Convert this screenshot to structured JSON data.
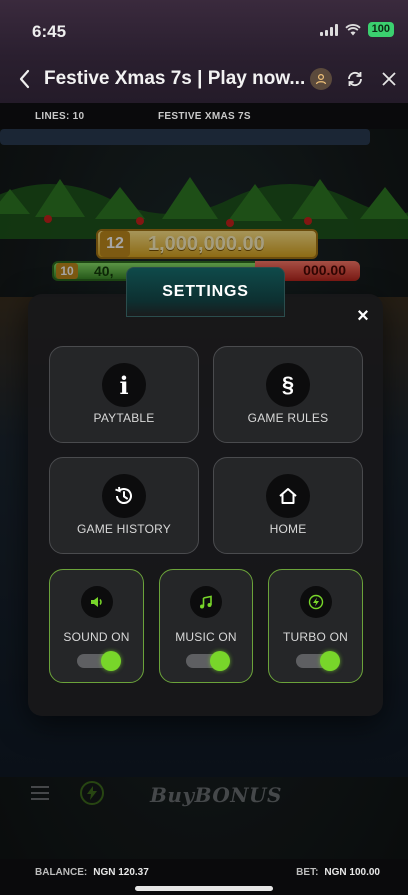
{
  "status": {
    "time": "6:45",
    "battery": "100"
  },
  "browser": {
    "title": "Festive Xmas 7s | Play now..."
  },
  "infobar": {
    "lines": "LINES: 10",
    "game_name": "FESTIVE XMAS 7S"
  },
  "jackpots": {
    "top_count": "12",
    "top_amount": "1,000,000.00",
    "second_count": "10",
    "second_amount": "40,",
    "second_right": "000.00"
  },
  "game_controls": {
    "buy_bonus": "BuyBONUS"
  },
  "settings": {
    "title": "SETTINGS",
    "close": "×",
    "tiles": {
      "paytable": "PAYTABLE",
      "game_rules": "GAME RULES",
      "game_history": "GAME HISTORY",
      "home": "HOME",
      "sound": "SOUND ON",
      "music": "MUSIC ON",
      "turbo": "TURBO ON"
    },
    "paytable_glyph": "i",
    "rules_glyph": "§",
    "accent_color": "#78d62a"
  },
  "footer": {
    "balance_label": "BALANCE:",
    "balance_value": "NGN 120.37",
    "bet_label": "BET:",
    "bet_value": "NGN 100.00"
  }
}
